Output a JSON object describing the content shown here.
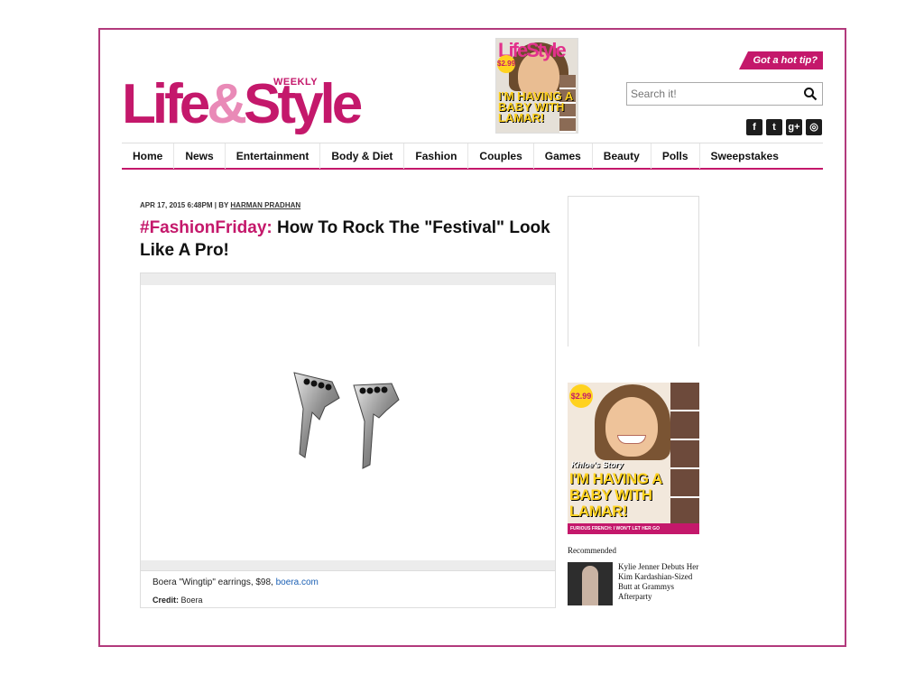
{
  "header": {
    "logo_weekly": "WEEKLY",
    "logo_part1": "Life",
    "logo_amp": "&",
    "logo_part2": "Style",
    "hot_tip": "Got a hot tip?",
    "search_placeholder": "Search it!",
    "social_icons": [
      "facebook-icon",
      "twitter-icon",
      "google-plus-icon",
      "instagram-icon"
    ]
  },
  "cover_small": {
    "title": "LifeStyle",
    "price": "$2.99",
    "headline": "I'M HAVING A BABY WITH LAMAR!"
  },
  "nav": {
    "items": [
      "Home",
      "News",
      "Entertainment",
      "Body & Diet",
      "Fashion",
      "Couples",
      "Games",
      "Beauty",
      "Polls",
      "Sweepstakes"
    ]
  },
  "article": {
    "date": "APR 17, 2015 6:48PM",
    "by": "BY",
    "author": "HARMAN PRADHAN",
    "headline_tag": "#FashionFriday:",
    "headline_rest": "How To Rock The \"Festival\" Look Like A Pro!",
    "caption_text": "Boera \"Wingtip\" earrings, $98,",
    "caption_link": "boera.com",
    "credit_label": "Credit:",
    "credit_value": "Boera"
  },
  "sidebar": {
    "cover_price": "$2.99",
    "cover_story": "Khloe's Story",
    "cover_headline": "I'M HAVING A BABY WITH LAMAR!",
    "cover_bottom": "FURIOUS FRENCH: I WON'T LET HER GO",
    "recommended_label": "Recommended",
    "recommended_title": "Kylie Jenner Debuts Her Kim Kardashian-Sized Butt at Grammys Afterparty"
  },
  "colors": {
    "brand": "#c4186b",
    "frame": "#b23a7c",
    "link": "#1a5fb4"
  }
}
